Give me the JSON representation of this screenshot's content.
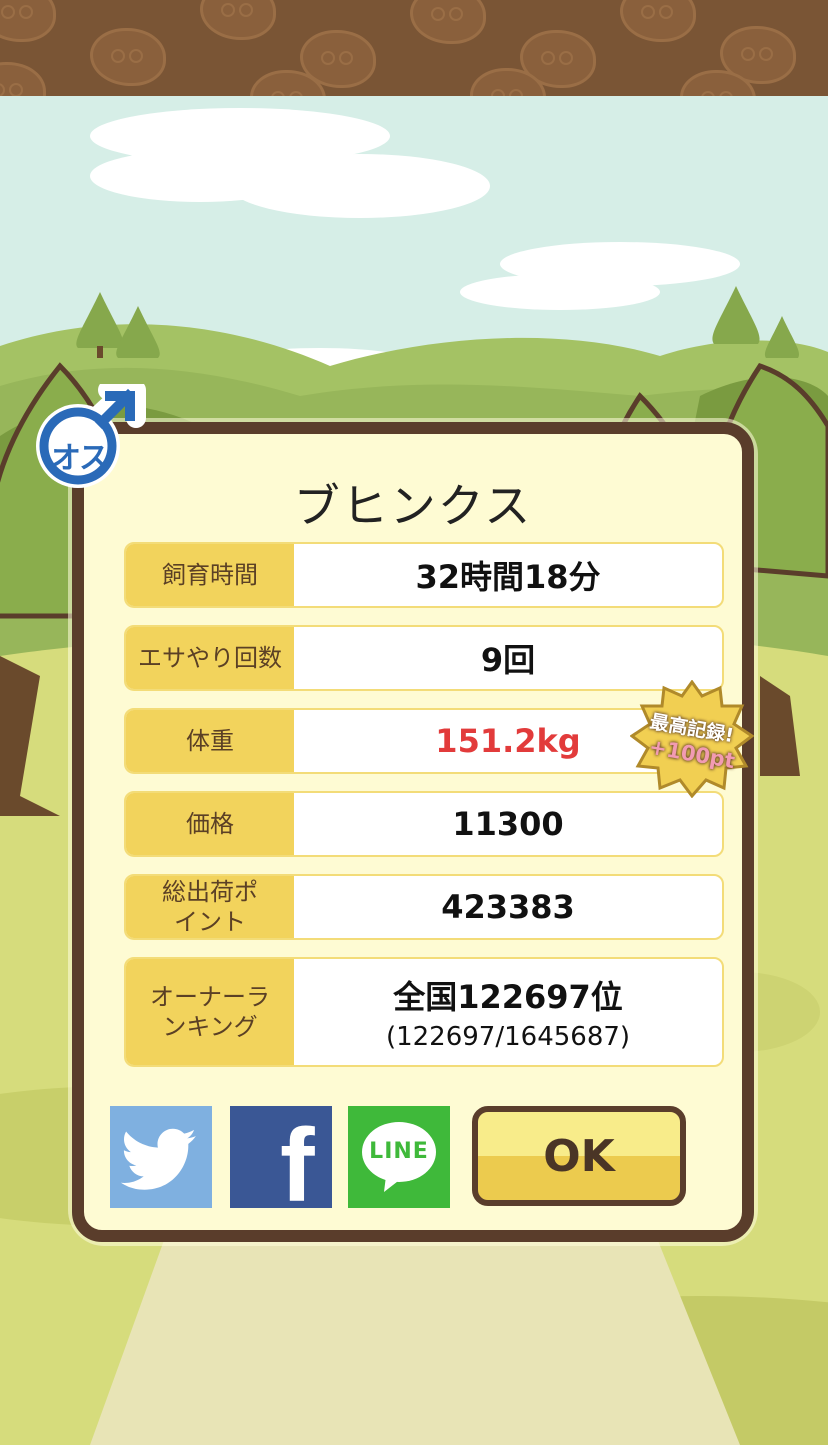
{
  "pet": {
    "gender_label": "オス",
    "name": "ブヒンクス"
  },
  "stats": [
    {
      "label": "飼育時間",
      "value": "32時間18分"
    },
    {
      "label": "エサやり回数",
      "value": "9回"
    },
    {
      "label": "体重",
      "value": "151.2kg"
    },
    {
      "label": "価格",
      "value": "11300"
    },
    {
      "label": "総出荷ポイント",
      "value": "423383"
    },
    {
      "label": "オーナーランキング",
      "value": "全国122697位",
      "detail": "(122697/1645687)"
    }
  ],
  "record_badge": {
    "line1": "最高記録!",
    "line2": "+100pt"
  },
  "buttons": {
    "ok_label": "OK",
    "line_label": "LINE",
    "facebook_label": "f"
  },
  "colors": {
    "frame": "#5a3d2b",
    "card": "#fefbd3",
    "label_bg": "#f2d35c",
    "highlight_value": "#e23b3b",
    "top_bar": "#7a5535"
  }
}
